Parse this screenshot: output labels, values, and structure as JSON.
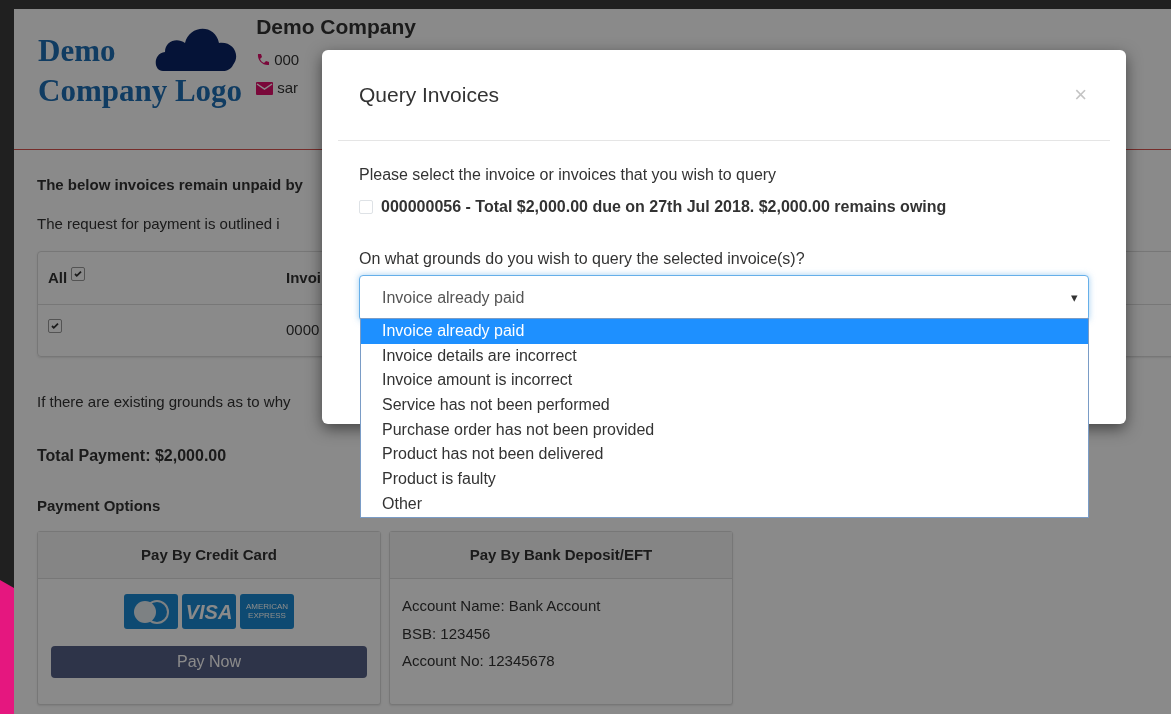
{
  "header": {
    "logo_lines": [
      "Demo",
      "Company Logo"
    ],
    "company_name": "Demo Company",
    "phone": "000",
    "email": "sar"
  },
  "intro": "The below invoices remain unpaid by",
  "request": "The request for payment is outlined i",
  "table": {
    "columns": [
      {
        "label": "All",
        "checked": true
      },
      {
        "label": "Invoi"
      }
    ],
    "rows": [
      {
        "checked": true,
        "cells": [
          "",
          "0000"
        ]
      }
    ]
  },
  "grounds_note": "If there are existing grounds as to why",
  "total": "Total Payment: $2,000.00",
  "payment_options_title": "Payment Options",
  "payment_options": [
    {
      "kind": "card",
      "title": "Pay By Credit Card",
      "logos": [
        {
          "kind": "mastercard"
        },
        {
          "kind": "visa",
          "label": "VISA"
        },
        {
          "kind": "amex",
          "label": "AMERICAN EXPRESS"
        }
      ],
      "button": "Pay Now"
    },
    {
      "kind": "bank",
      "title": "Pay By Bank Deposit/EFT",
      "lines": [
        "Account Name: Bank Account",
        "BSB: 123456",
        "Account No: 12345678"
      ]
    }
  ],
  "modal": {
    "title": "Query Invoices",
    "close": "×",
    "prompt": "Please select the invoice or invoices that you wish to query",
    "invoices": [
      {
        "label": "000000056 - Total $2,000.00 due on 27th Jul 2018. $2,000.00 remains owing",
        "checked": false
      }
    ],
    "question": "On what grounds do you wish to query the selected invoice(s)?",
    "select": {
      "value": "Invoice already paid",
      "arrow": "▾",
      "expanded": true,
      "options": [
        {
          "label": "Invoice already paid",
          "selected": true
        },
        {
          "label": "Invoice details are incorrect",
          "selected": false
        },
        {
          "label": "Invoice amount is incorrect",
          "selected": false
        },
        {
          "label": "Service has not been performed",
          "selected": false
        },
        {
          "label": "Purchase order has not been provided",
          "selected": false
        },
        {
          "label": "Product has not been delivered",
          "selected": false
        },
        {
          "label": "Product is faulty",
          "selected": false
        },
        {
          "label": "Other",
          "selected": false
        }
      ]
    }
  }
}
